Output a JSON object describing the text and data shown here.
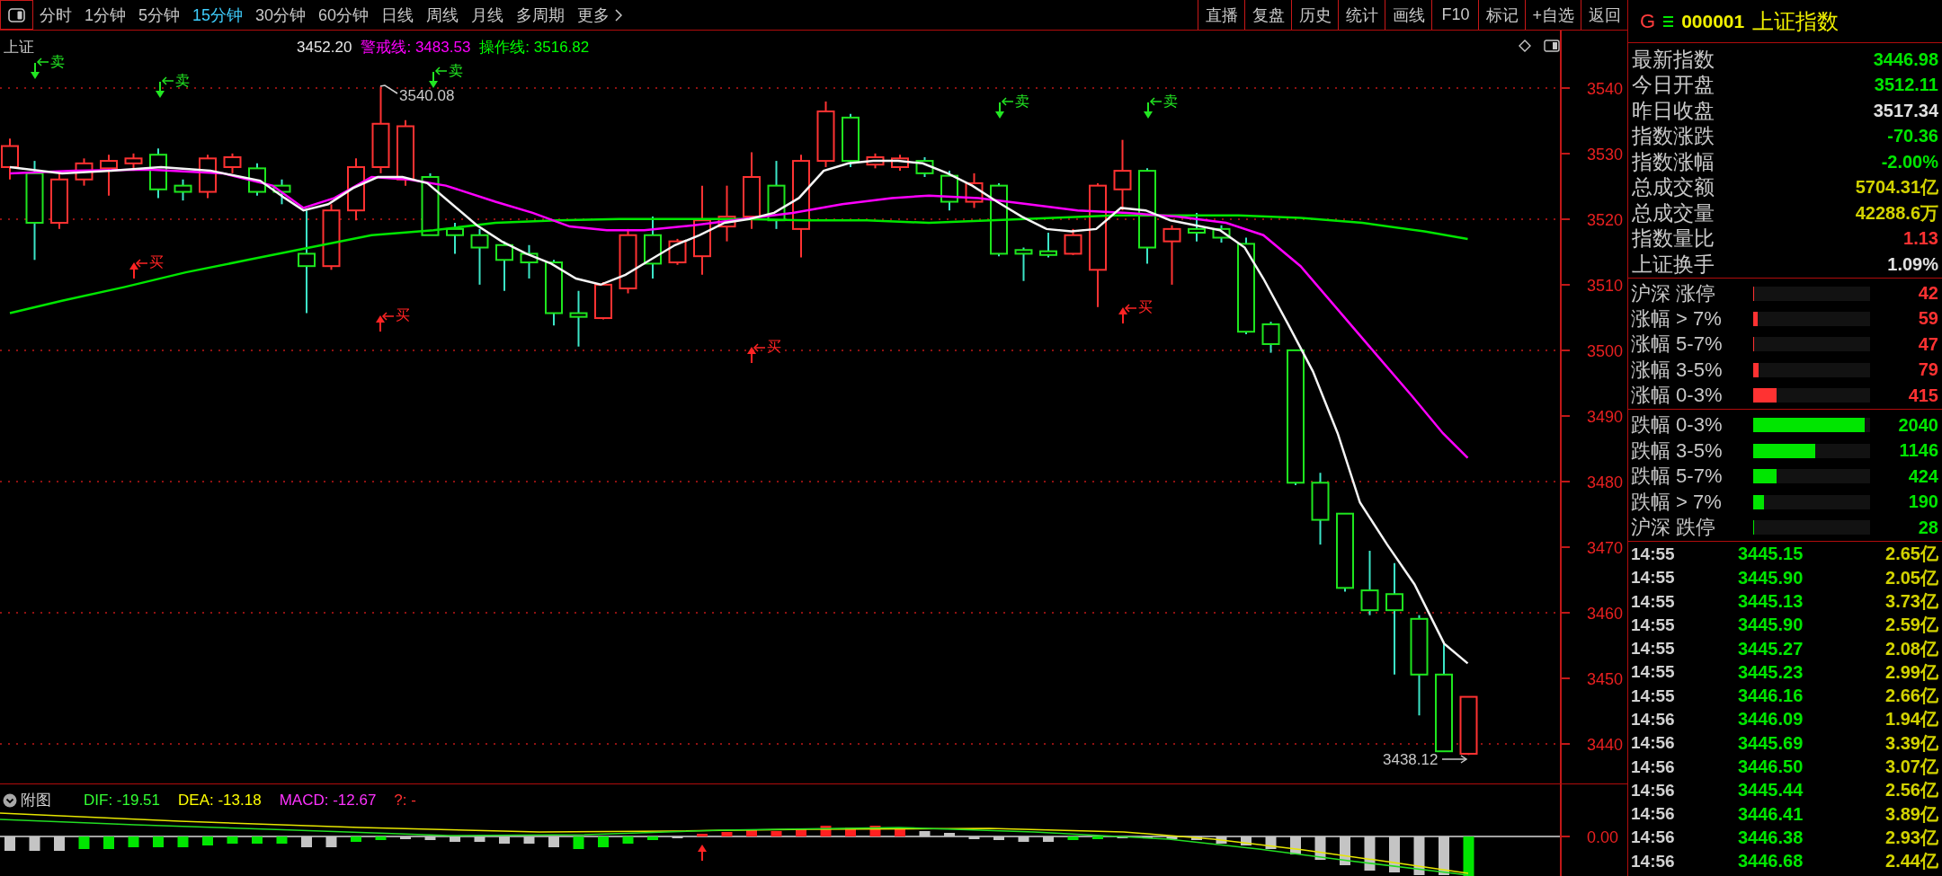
{
  "toolbar": {
    "periods": [
      {
        "label": "分时",
        "selected": false
      },
      {
        "label": "1分钟",
        "selected": false
      },
      {
        "label": "5分钟",
        "selected": false
      },
      {
        "label": "15分钟",
        "selected": true
      },
      {
        "label": "30分钟",
        "selected": false
      },
      {
        "label": "60分钟",
        "selected": false
      },
      {
        "label": "日线",
        "selected": false
      },
      {
        "label": "周线",
        "selected": false
      },
      {
        "label": "月线",
        "selected": false
      },
      {
        "label": "多周期",
        "selected": false
      }
    ],
    "more": {
      "label": "更多"
    },
    "actions": [
      "直播",
      "复盘",
      "历史",
      "统计",
      "画线",
      "F10",
      "标记",
      "+自选",
      "返回"
    ]
  },
  "main_chart": {
    "title": "上证",
    "ma_value": "3452.20",
    "indicators": [
      {
        "label": "警戒线: 3483.53",
        "color": "#ff00ff"
      },
      {
        "label": "操作线: 3516.82",
        "color": "#00ff00"
      }
    ],
    "price_axis": [
      "3540",
      "3530",
      "3520",
      "3510",
      "3500",
      "3490",
      "3480",
      "3470",
      "3460",
      "3450",
      "3440"
    ],
    "high_label": "3540.08",
    "low_label": "3438.12",
    "signals": [
      {
        "kind": "sell",
        "label": "卖"
      },
      {
        "kind": "buy",
        "label": "买"
      },
      {
        "kind": "sell",
        "label": "卖"
      },
      {
        "kind": "buy",
        "label": "买"
      },
      {
        "kind": "sell",
        "label": "卖"
      },
      {
        "kind": "buy",
        "label": "买"
      },
      {
        "kind": "sell",
        "label": "卖"
      },
      {
        "kind": "buy",
        "label": "买"
      },
      {
        "kind": "sell",
        "label": "卖"
      }
    ]
  },
  "sub_chart": {
    "title": "附图",
    "indicators": [
      {
        "label": "DIF: -19.51",
        "color": "#33ff33"
      },
      {
        "label": "DEA: -13.18",
        "color": "#ffff00"
      },
      {
        "label": "MACD: -12.67",
        "color": "#ff33ff"
      },
      {
        "label": "?: -",
        "color": "#ff3030"
      }
    ],
    "zero_label": "0.00"
  },
  "quote": {
    "market": "G",
    "code": "000001",
    "name": "上证指数"
  },
  "stats": [
    {
      "label": "最新指数",
      "value": "3446.98",
      "color": "#00e600"
    },
    {
      "label": "今日开盘",
      "value": "3512.11",
      "color": "#00e600"
    },
    {
      "label": "昨日收盘",
      "value": "3517.34",
      "color": "#e0e0e0"
    },
    {
      "label": "指数涨跌",
      "value": "-70.36",
      "color": "#00e600"
    },
    {
      "label": "指数涨幅",
      "value": "-2.00%",
      "color": "#00e600"
    },
    {
      "label": "总成交额",
      "value": "5704.31亿",
      "color": "#d2d200"
    },
    {
      "label": "总成交量",
      "value": "42288.6万",
      "color": "#d2d200"
    },
    {
      "label": "指数量比",
      "value": "1.13",
      "color": "#ff3232"
    },
    {
      "label": "上证换手",
      "value": "1.09%",
      "color": "#e0e0e0"
    }
  ],
  "breadth_up": [
    {
      "label": "沪深 涨停",
      "count": "42",
      "level": 0.01
    },
    {
      "label": "涨幅 > 7%",
      "count": "59",
      "level": 0.035
    },
    {
      "label": "涨幅 5-7%",
      "count": "47",
      "level": 0.01
    },
    {
      "label": "涨幅 3-5%",
      "count": "79",
      "level": 0.045
    },
    {
      "label": "涨幅 0-3%",
      "count": "415",
      "level": 0.2
    }
  ],
  "breadth_down": [
    {
      "label": "跌幅 0-3%",
      "count": "2040",
      "level": 0.95
    },
    {
      "label": "跌幅 3-5%",
      "count": "1146",
      "level": 0.53
    },
    {
      "label": "跌幅 5-7%",
      "count": "424",
      "level": 0.2
    },
    {
      "label": "跌幅 > 7%",
      "count": "190",
      "level": 0.09
    },
    {
      "label": "沪深 跌停",
      "count": "28",
      "level": 0.01
    }
  ],
  "ticks": [
    {
      "time": "14:55",
      "price": "3445.15",
      "amount": "2.65亿"
    },
    {
      "time": "14:55",
      "price": "3445.90",
      "amount": "2.05亿"
    },
    {
      "time": "14:55",
      "price": "3445.13",
      "amount": "3.73亿"
    },
    {
      "time": "14:55",
      "price": "3445.90",
      "amount": "2.59亿"
    },
    {
      "time": "14:55",
      "price": "3445.27",
      "amount": "2.08亿"
    },
    {
      "time": "14:55",
      "price": "3445.23",
      "amount": "2.99亿"
    },
    {
      "time": "14:55",
      "price": "3446.16",
      "amount": "2.66亿"
    },
    {
      "time": "14:56",
      "price": "3446.09",
      "amount": "1.94亿"
    },
    {
      "time": "14:56",
      "price": "3445.69",
      "amount": "3.39亿"
    },
    {
      "time": "14:56",
      "price": "3446.50",
      "amount": "3.07亿"
    },
    {
      "time": "14:56",
      "price": "3445.44",
      "amount": "2.56亿"
    },
    {
      "time": "14:56",
      "price": "3446.41",
      "amount": "3.89亿"
    },
    {
      "time": "14:56",
      "price": "3446.38",
      "amount": "2.93亿"
    },
    {
      "time": "14:56",
      "price": "3446.68",
      "amount": "2.44亿"
    }
  ]
}
